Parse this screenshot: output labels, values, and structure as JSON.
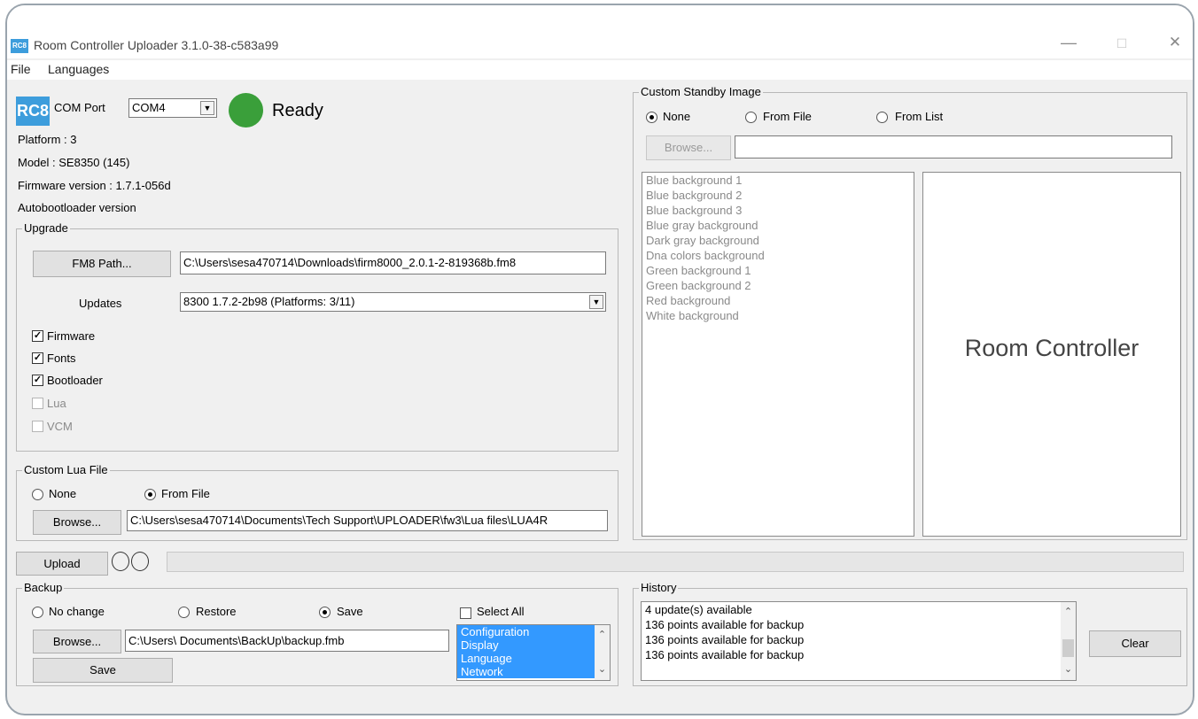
{
  "window": {
    "icon_text": "RC8",
    "title": "Room Controller Uploader 3.1.0-38-c583a99",
    "minimize": "—",
    "maximize": "☐",
    "close": "✕"
  },
  "menu": [
    "File",
    "Languages"
  ],
  "device": {
    "logo": "RC8",
    "com_port_label": "COM Port",
    "com_port_value": "COM4",
    "status": "Ready",
    "status_color": "#3a9f3a",
    "platform": "Platform : 3",
    "model": "Model : SE8350 (145)",
    "firmware": "Firmware version : 1.7.1-056d",
    "autobootloader": "Autobootloader version"
  },
  "upgrade": {
    "title": "Upgrade",
    "fm8_button": "FM8 Path...",
    "fm8_path": "C:\\Users\\sesa470714\\Downloads\\firm8000_2.0.1-2-819368b.fm8",
    "updates_label": "Updates",
    "updates_value": "8300 1.7.2-2b98 (Platforms: 3/11)",
    "options": [
      {
        "label": "Firmware",
        "checked": true,
        "enabled": true
      },
      {
        "label": "Fonts",
        "checked": true,
        "enabled": true
      },
      {
        "label": "Bootloader",
        "checked": true,
        "enabled": true
      },
      {
        "label": "Lua",
        "checked": false,
        "enabled": false
      },
      {
        "label": "VCM",
        "checked": false,
        "enabled": false
      }
    ]
  },
  "lua": {
    "title": "Custom Lua File",
    "none_label": "None",
    "from_file_label": "From File",
    "browse_button": "Browse...",
    "path": "C:\\Users\\sesa470714\\Documents\\Tech Support\\UPLOADER\\fw3\\Lua files\\LUA4R"
  },
  "upload": {
    "button": "Upload"
  },
  "standby": {
    "title": "Custom Standby Image",
    "none_label": "None",
    "from_file_label": "From File",
    "from_list_label": "From List",
    "browse_button": "Browse...",
    "path": "",
    "images": [
      "Blue background 1",
      "Blue background 2",
      "Blue background 3",
      "Blue gray background",
      "Dark gray background",
      "Dna colors background",
      "Green background 1",
      "Green background 2",
      "Red background",
      "White background"
    ],
    "preview_text": "Room Controller"
  },
  "backup": {
    "title": "Backup",
    "no_change_label": "No change",
    "restore_label": "Restore",
    "save_label": "Save",
    "select_all_label": "Select All",
    "browse_button": "Browse...",
    "path": "C:\\Users\\ Documents\\BackUp\\backup.fmb",
    "save_button": "Save",
    "items": [
      "Configuration",
      "Display",
      "Language",
      "Network"
    ]
  },
  "history": {
    "title": "History",
    "lines": [
      "4 update(s) available",
      "136 points available for backup",
      "136 points available for backup",
      "136 points available for backup"
    ],
    "clear_button": "Clear"
  }
}
